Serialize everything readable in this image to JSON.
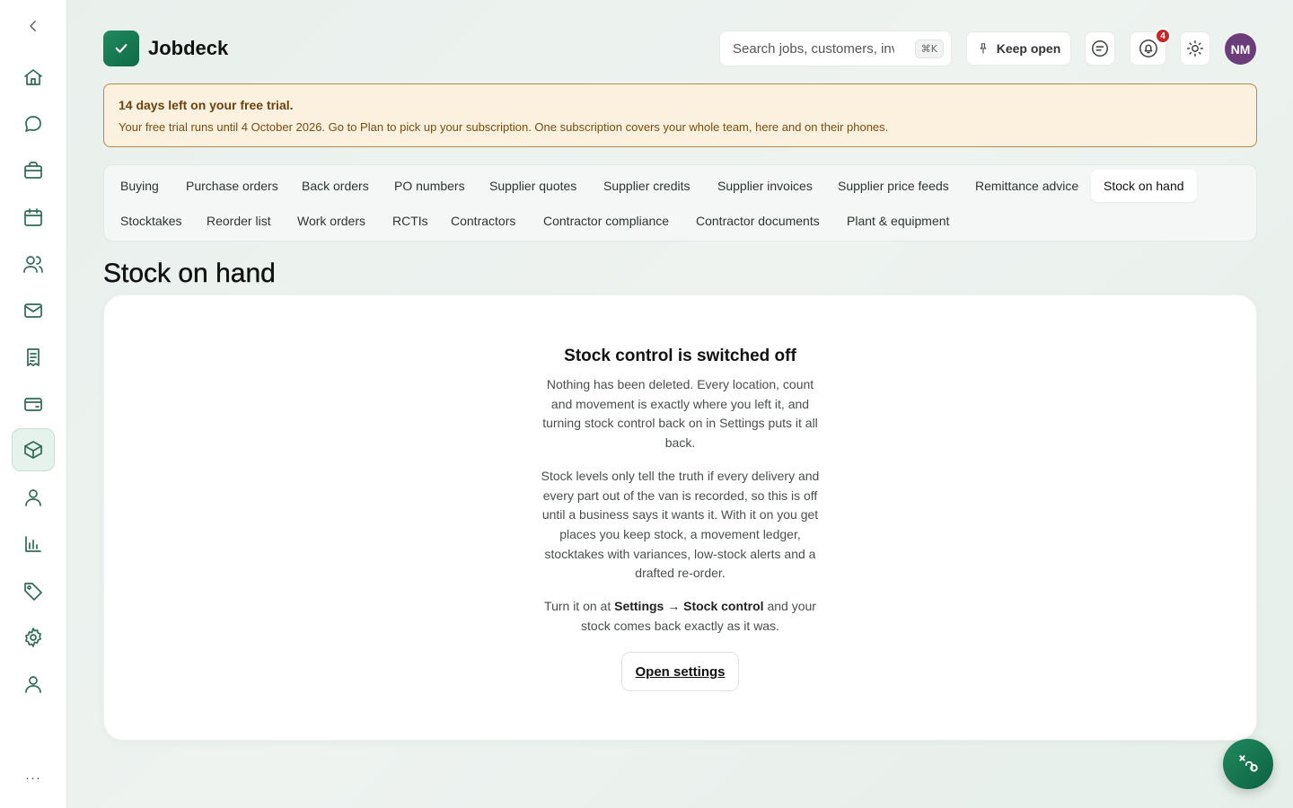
{
  "app": {
    "name": "Jobdeck"
  },
  "sidebar": {
    "items": [
      {
        "icon": "home-icon"
      },
      {
        "icon": "chat-icon"
      },
      {
        "icon": "briefcase-icon"
      },
      {
        "icon": "calendar-icon"
      },
      {
        "icon": "users-icon"
      },
      {
        "icon": "mail-icon"
      },
      {
        "icon": "receipt-icon"
      },
      {
        "icon": "wallet-icon"
      },
      {
        "icon": "box-icon",
        "active": true
      },
      {
        "icon": "person-icon"
      },
      {
        "icon": "bar-chart-icon"
      },
      {
        "icon": "tag-icon"
      },
      {
        "icon": "gear-icon"
      },
      {
        "icon": "account-icon"
      }
    ],
    "more_label": "···"
  },
  "header": {
    "search_placeholder": "Search jobs, customers, invoices",
    "search_shortcut": "⌘K",
    "keep_open_label": "Keep open",
    "notifications_count": "4",
    "avatar_initials": "NM"
  },
  "trial": {
    "title": "14 days left on your free trial.",
    "body": "Your free trial runs until 4 October 2026. Go to Plan to pick up your subscription. One subscription covers your whole team, here and on their phones."
  },
  "tabs": [
    "Buying",
    "Purchase orders",
    "Back orders",
    "PO numbers",
    "Supplier quotes",
    "Supplier credits",
    "Supplier invoices",
    "Supplier price feeds",
    "Remittance advice",
    "Stock on hand",
    "Stocktakes",
    "Reorder list",
    "Work orders",
    "RCTIs",
    "Contractors",
    "Contractor compliance",
    "Contractor documents",
    "Plant & equipment"
  ],
  "active_tab": "Stock on hand",
  "page": {
    "title": "Stock on hand"
  },
  "empty_state": {
    "heading": "Stock control is switched off",
    "para1": "Nothing has been deleted. Every location, count and movement is exactly where you left it, and turning stock control back on in Settings puts it all back.",
    "para2": "Stock levels only tell the truth if every delivery and every part out of the van is recorded, so this is off until a business says it wants it. With it on you get places you keep stock, a movement ledger, stocktakes with variances, low-stock alerts and a drafted re-order.",
    "para3_prefix": "Turn it on at ",
    "para3_bold": "Settings → Stock control",
    "para3_suffix": " and your stock comes back exactly as it was.",
    "button_label": "Open settings"
  },
  "colors": {
    "brand": "#1f8a5e",
    "trial_bg": "#fcf0de",
    "trial_border": "#b78a3f",
    "badge": "#c62828",
    "avatar": "#6b3d7a"
  }
}
